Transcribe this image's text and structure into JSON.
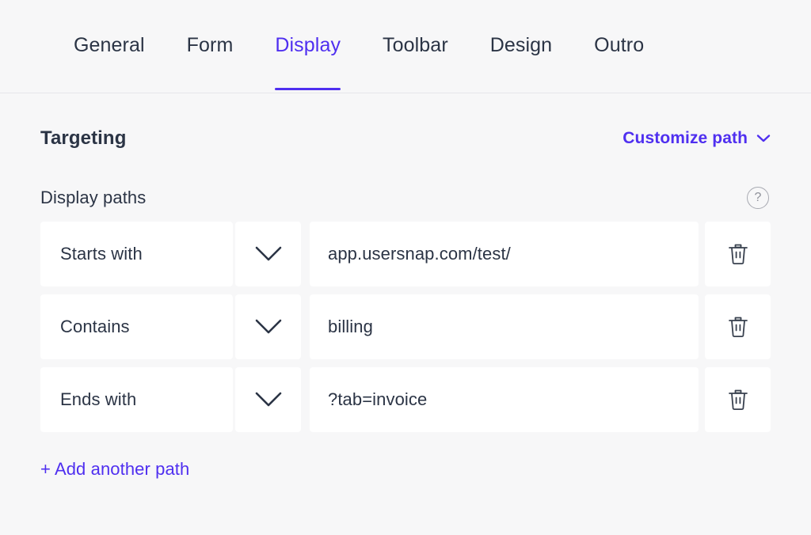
{
  "tabs": [
    {
      "label": "General",
      "active": false
    },
    {
      "label": "Form",
      "active": false
    },
    {
      "label": "Display",
      "active": true
    },
    {
      "label": "Toolbar",
      "active": false
    },
    {
      "label": "Design",
      "active": false
    },
    {
      "label": "Outro",
      "active": false
    }
  ],
  "section": {
    "title": "Targeting",
    "customize_path_label": "Customize path",
    "customize_path_icon": "chevron-down-icon"
  },
  "display_paths": {
    "label": "Display paths",
    "help_icon": "question-mark-circle-icon",
    "rows": [
      {
        "match_type": "Starts with",
        "dropdown_icon": "chevron-down-icon",
        "value": "app.usersnap.com/test/",
        "placeholder": "Enter path",
        "delete_icon": "trash-icon"
      },
      {
        "match_type": "Contains",
        "dropdown_icon": "chevron-down-icon",
        "value": "billing",
        "placeholder": "Enter path",
        "delete_icon": "trash-icon"
      },
      {
        "match_type": "Ends with",
        "dropdown_icon": "chevron-down-icon",
        "value": "?tab=invoice",
        "placeholder": "Enter path",
        "delete_icon": "trash-icon"
      }
    ],
    "add_another_label": "+ Add another path"
  },
  "colors": {
    "accent": "#4f2ff0",
    "text": "#2b3445",
    "page_background": "#f7f7f8",
    "field_background": "#ffffff",
    "muted": "#8e9099"
  }
}
